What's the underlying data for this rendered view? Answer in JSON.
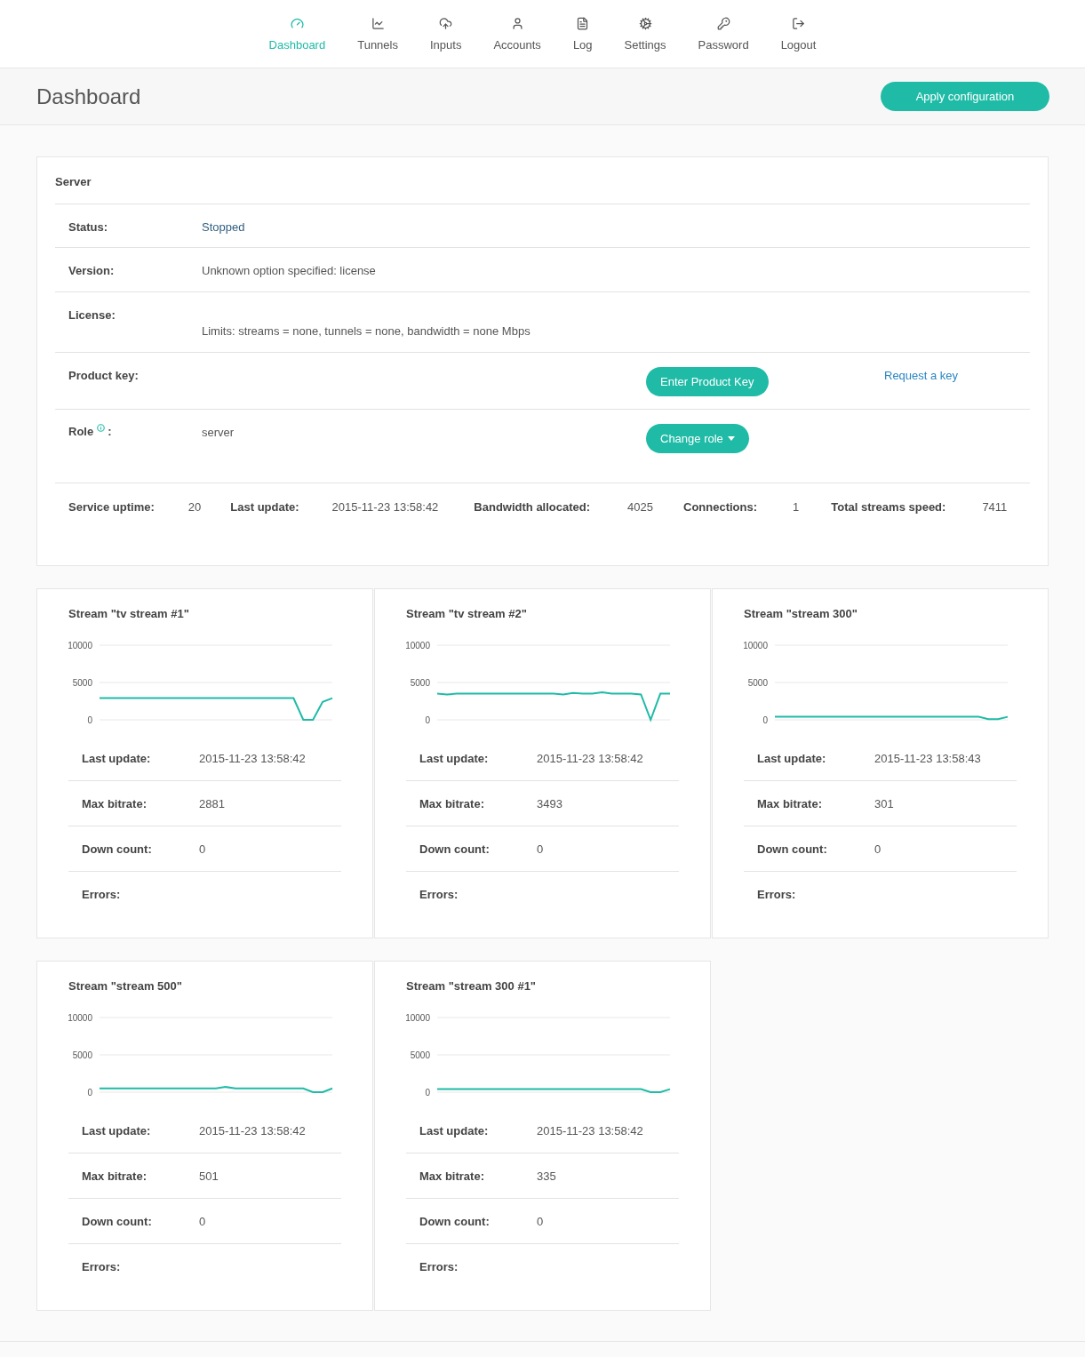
{
  "nav": [
    {
      "label": "Dashboard",
      "selected": true
    },
    {
      "label": "Tunnels",
      "selected": false
    },
    {
      "label": "Inputs",
      "selected": false
    },
    {
      "label": "Accounts",
      "selected": false
    },
    {
      "label": "Log",
      "selected": false
    },
    {
      "label": "Settings",
      "selected": false
    },
    {
      "label": "Password",
      "selected": false
    },
    {
      "label": "Logout",
      "selected": false
    }
  ],
  "page_title": "Dashboard",
  "apply_button": "Apply configuration",
  "server": {
    "title": "Server",
    "status": {
      "label": "Status:",
      "value": "Stopped"
    },
    "version": {
      "label": "Version:",
      "value": "Unknown option specified: license"
    },
    "license": {
      "label": "License:",
      "value": "Limits: streams = none, tunnels = none, bandwidth = none Mbps"
    },
    "product_key": {
      "label": "Product key:",
      "button": "Enter Product Key",
      "link": "Request a key"
    },
    "role": {
      "label": "Role",
      "separator": ":",
      "value": "server",
      "button": "Change role"
    },
    "stats": [
      {
        "label": "Service uptime:",
        "value": "20"
      },
      {
        "label": "Last update:",
        "value": "2015-11-23 13:58:42"
      },
      {
        "label": "Bandwidth allocated:",
        "value": "4025"
      },
      {
        "label": "Connections:",
        "value": "1"
      },
      {
        "label": "Total streams speed:",
        "value": "7411"
      }
    ]
  },
  "streams": [
    {
      "title": "Stream \"tv stream #1\"",
      "chart_data": {
        "type": "line",
        "ylim": [
          0,
          10000
        ],
        "yticks": [
          0,
          5000,
          10000
        ],
        "series": [
          {
            "color": "#1fbba6",
            "values": [
              2900,
              2900,
              2900,
              2900,
              2900,
              2900,
              2900,
              2900,
              2900,
              2900,
              2900,
              2900,
              2900,
              2900,
              2900,
              2900,
              2900,
              2900,
              2900,
              2900,
              2900,
              0,
              0,
              2400,
              2900
            ]
          }
        ]
      },
      "details": [
        {
          "label": "Last update:",
          "value": "2015-11-23 13:58:42"
        },
        {
          "label": "Max bitrate:",
          "value": "2881"
        },
        {
          "label": "Down count:",
          "value": "0"
        },
        {
          "label": "Errors:"
        }
      ]
    },
    {
      "title": "Stream \"tv stream #2\"",
      "chart_data": {
        "type": "line",
        "ylim": [
          0,
          10000
        ],
        "yticks": [
          0,
          5000,
          10000
        ],
        "series": [
          {
            "color": "#1fbba6",
            "values": [
              3500,
              3400,
              3500,
              3500,
              3500,
              3500,
              3500,
              3500,
              3500,
              3500,
              3500,
              3500,
              3500,
              3400,
              3600,
              3500,
              3500,
              3700,
              3500,
              3500,
              3500,
              3400,
              0,
              3500,
              3500
            ]
          }
        ]
      },
      "details": [
        {
          "label": "Last update:",
          "value": "2015-11-23 13:58:42"
        },
        {
          "label": "Max bitrate:",
          "value": "3493"
        },
        {
          "label": "Down count:",
          "value": "0"
        },
        {
          "label": "Errors:"
        }
      ]
    },
    {
      "title": "Stream \"stream 300\"",
      "chart_data": {
        "type": "line",
        "ylim": [
          0,
          10000
        ],
        "yticks": [
          0,
          5000,
          10000
        ],
        "series": [
          {
            "color": "#1fbba6",
            "values": [
              400,
              400,
              400,
              400,
              400,
              400,
              400,
              400,
              400,
              400,
              400,
              400,
              400,
              400,
              400,
              400,
              400,
              400,
              400,
              400,
              400,
              400,
              100,
              100,
              400
            ]
          }
        ]
      },
      "details": [
        {
          "label": "Last update:",
          "value": "2015-11-23 13:58:43"
        },
        {
          "label": "Max bitrate:",
          "value": "301"
        },
        {
          "label": "Down count:",
          "value": "0"
        },
        {
          "label": "Errors:"
        }
      ]
    },
    {
      "title": "Stream \"stream 500\"",
      "chart_data": {
        "type": "line",
        "ylim": [
          0,
          10000
        ],
        "yticks": [
          0,
          5000,
          10000
        ],
        "series": [
          {
            "color": "#1fbba6",
            "values": [
              500,
              500,
              500,
              500,
              500,
              500,
              500,
              500,
              500,
              500,
              500,
              500,
              500,
              700,
              500,
              500,
              500,
              500,
              500,
              500,
              500,
              500,
              0,
              0,
              500
            ]
          }
        ]
      },
      "details": [
        {
          "label": "Last update:",
          "value": "2015-11-23 13:58:42"
        },
        {
          "label": "Max bitrate:",
          "value": "501"
        },
        {
          "label": "Down count:",
          "value": "0"
        },
        {
          "label": "Errors:"
        }
      ]
    },
    {
      "title": "Stream \"stream 300 #1\"",
      "chart_data": {
        "type": "line",
        "ylim": [
          0,
          10000
        ],
        "yticks": [
          0,
          5000,
          10000
        ],
        "series": [
          {
            "color": "#1fbba6",
            "values": [
              400,
              400,
              400,
              400,
              400,
              400,
              400,
              400,
              400,
              400,
              400,
              400,
              400,
              400,
              400,
              400,
              400,
              400,
              400,
              400,
              400,
              400,
              0,
              0,
              400
            ]
          }
        ]
      },
      "details": [
        {
          "label": "Last update:",
          "value": "2015-11-23 13:58:42"
        },
        {
          "label": "Max bitrate:",
          "value": "335"
        },
        {
          "label": "Down count:",
          "value": "0"
        },
        {
          "label": "Errors:"
        }
      ]
    }
  ]
}
